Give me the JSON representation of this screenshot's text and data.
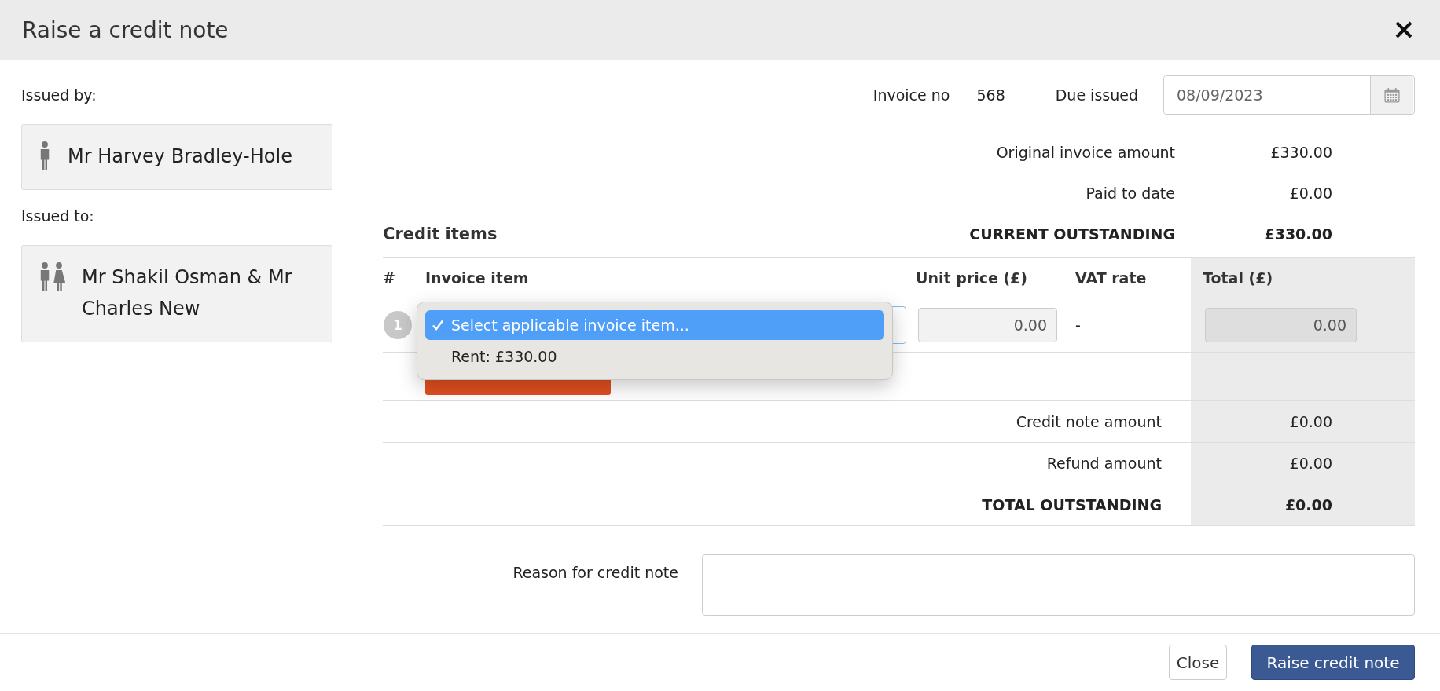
{
  "dialog": {
    "title": "Raise a credit note"
  },
  "issued_by": {
    "label": "Issued by:",
    "name": "Mr Harvey Bradley-Hole",
    "kind": "person"
  },
  "issued_to": {
    "label": "Issued to:",
    "name": "Mr Shakil Osman & Mr Charles New",
    "kind": "couple"
  },
  "invoice": {
    "label": "Invoice no",
    "value": "568"
  },
  "date_field": {
    "label": "Due issued",
    "value": "08/09/2023"
  },
  "summary": [
    {
      "label": "Original invoice amount",
      "value": "£330.00",
      "kind": "normal"
    },
    {
      "label": "Paid to date",
      "value": "£0.00",
      "kind": "normal"
    },
    {
      "label": "CURRENT OUTSTANDING",
      "value": "£330.00",
      "kind": "total"
    }
  ],
  "credit_items": {
    "title": "Credit items",
    "columns": [
      "#",
      "Invoice item",
      "Unit price (£)",
      "VAT rate",
      "Total (£)"
    ],
    "rows": [
      {
        "number": "1",
        "unit_price": "0.00",
        "vat_rate": "-",
        "total": "0.00"
      }
    ]
  },
  "dropdown": {
    "options": [
      {
        "label": "Select applicable invoice item...",
        "selected": true
      },
      {
        "label": "Rent: £330.00",
        "selected": false
      }
    ]
  },
  "totals": [
    {
      "label": "Credit note amount",
      "value": "£0.00",
      "kind": "normal"
    },
    {
      "label": "Refund amount",
      "value": "£0.00",
      "kind": "normal"
    },
    {
      "label": "TOTAL OUTSTANDING",
      "value": "£0.00",
      "kind": "total"
    }
  ],
  "reason": {
    "label": "Reason for credit note"
  },
  "buttons": [
    {
      "label": "Close",
      "kind": "secondary"
    },
    {
      "label": "Raise credit note",
      "kind": "primary"
    }
  ]
}
